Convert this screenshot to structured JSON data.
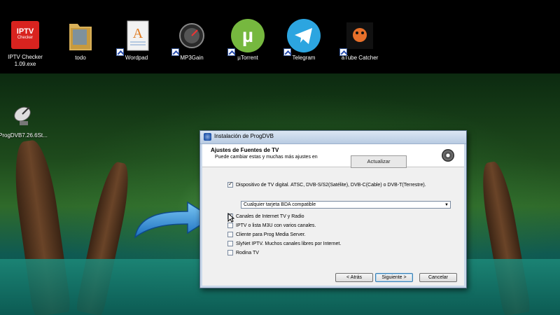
{
  "desktop": {
    "icons": [
      {
        "label": "IPTV Checker\n1.09.exe",
        "icon": "iptv-checker-icon"
      },
      {
        "label": "todo",
        "icon": "folder-icon"
      },
      {
        "label": "Wordpad",
        "icon": "wordpad-icon"
      },
      {
        "label": "MP3Gain",
        "icon": "mp3gain-icon"
      },
      {
        "label": "µTorrent",
        "icon": "utorrent-icon"
      },
      {
        "label": "Telegram",
        "icon": "telegram-icon"
      },
      {
        "label": "aTube Catcher",
        "icon": "atube-catcher-icon"
      },
      {
        "label": "ProgDVB7.26.6St...",
        "icon": "satellite-dish-icon"
      }
    ],
    "iptv_badge": "IPTV",
    "iptv_badge_sub": "Checker"
  },
  "dialog": {
    "title": "Instalación de ProgDVB",
    "header_title": "Ajustes de Fuentes de TV",
    "header_subtitle": "Puede cambiar estas y muchas más ajustes en",
    "tooltip": "Actualizar",
    "options": [
      {
        "label": "Dispositivo de TV digital. ATSC, DVB-S/S2(Satélite), DVB-C(Cable) o DVB-T(Terrestre).",
        "checked": true
      },
      {
        "label": "Canales de Internet TV y Radio",
        "checked": true
      },
      {
        "label": "IPTV o lista M3U con varios canales.",
        "checked": false
      },
      {
        "label": "Cliente para Prog Media Server.",
        "checked": false
      },
      {
        "label": "SlyNet IPTV. Muchos canales libres por Internet.",
        "checked": false
      },
      {
        "label": "Rodina TV",
        "checked": false
      }
    ],
    "combo_value": "Cualquier tarjeta BDA compatible",
    "buttons": {
      "back": "< Atrás",
      "next": "Siguiente >",
      "cancel": "Cancelar"
    }
  },
  "colors": {
    "telegram": "#2ca5e0",
    "utorrent": "#76b83f",
    "iptv_red": "#d8231f",
    "arrow_blue": "#2a8fd8"
  }
}
